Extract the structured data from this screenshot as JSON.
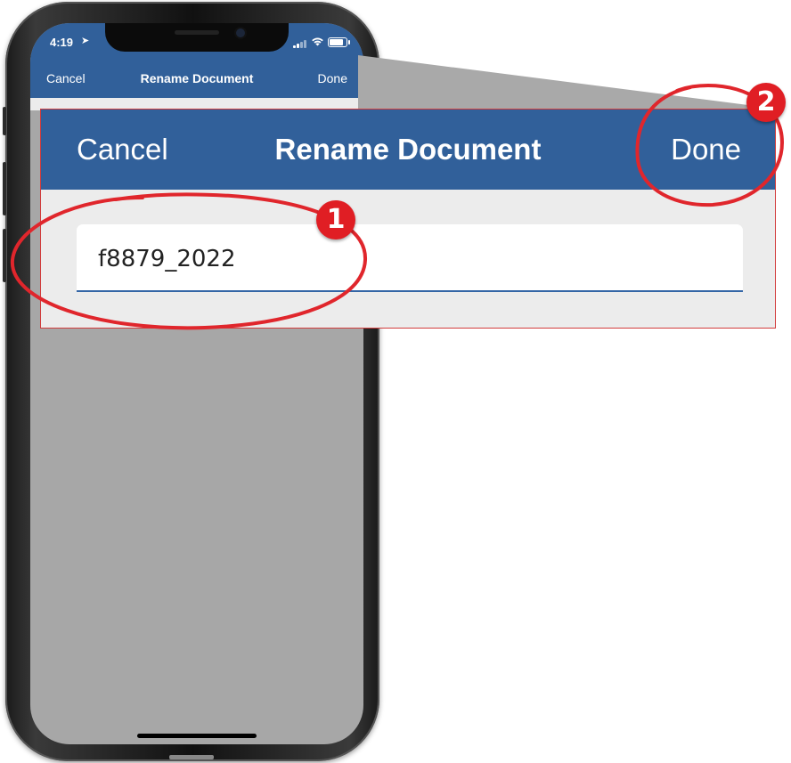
{
  "phone": {
    "status_time": "4:19",
    "nav": {
      "cancel": "Cancel",
      "title": "Rename Document",
      "done": "Done"
    }
  },
  "zoom": {
    "nav": {
      "cancel": "Cancel",
      "title": "Rename Document",
      "done": "Done"
    },
    "field_value": "f8879_2022"
  },
  "annotations": [
    {
      "number": "1",
      "target": "document name field"
    },
    {
      "number": "2",
      "target": "Done button"
    }
  ],
  "colors": {
    "nav_blue": "#31609a",
    "annotation_red": "#e01e24",
    "field_underline": "#3466a6"
  },
  "icons": [
    "location-arrow-icon",
    "signal-icon",
    "wifi-icon",
    "battery-icon"
  ]
}
